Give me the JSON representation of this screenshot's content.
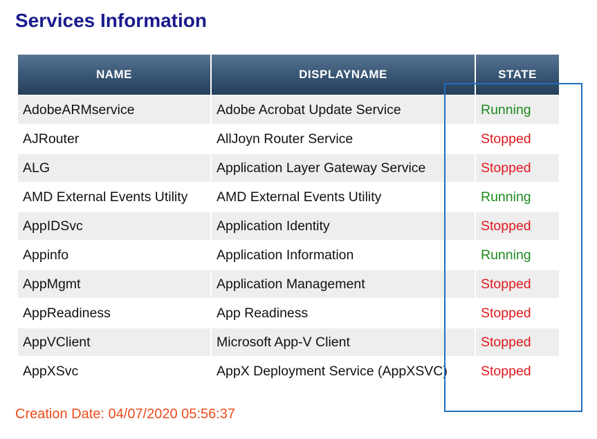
{
  "page_title": "Services Information",
  "table": {
    "headers": {
      "name": "NAME",
      "displayname": "DISPLAYNAME",
      "state": "STATE"
    },
    "rows": [
      {
        "name": "AdobeARMservice",
        "displayname": "Adobe Acrobat Update Service",
        "state": "Running"
      },
      {
        "name": "AJRouter",
        "displayname": "AllJoyn Router Service",
        "state": "Stopped"
      },
      {
        "name": "ALG",
        "displayname": "Application Layer Gateway Service",
        "state": "Stopped"
      },
      {
        "name": "AMD External Events Utility",
        "displayname": "AMD External Events Utility",
        "state": "Running"
      },
      {
        "name": "AppIDSvc",
        "displayname": "Application Identity",
        "state": "Stopped"
      },
      {
        "name": "Appinfo",
        "displayname": "Application Information",
        "state": "Running"
      },
      {
        "name": "AppMgmt",
        "displayname": "Application Management",
        "state": "Stopped"
      },
      {
        "name": "AppReadiness",
        "displayname": "App Readiness",
        "state": "Stopped"
      },
      {
        "name": "AppVClient",
        "displayname": "Microsoft App-V Client",
        "state": "Stopped"
      },
      {
        "name": "AppXSvc",
        "displayname": "AppX Deployment Service (AppXSVC)",
        "state": "Stopped"
      }
    ]
  },
  "creation_date": "Creation Date: 04/07/2020 05:56:37",
  "colors": {
    "title": "#1a1a8c",
    "header_bg": "#3c5a78",
    "running": "#1e8a1e",
    "stopped": "#e0181e",
    "creation_date": "#ee4a1c",
    "highlight_box": "#1f6fc0"
  }
}
